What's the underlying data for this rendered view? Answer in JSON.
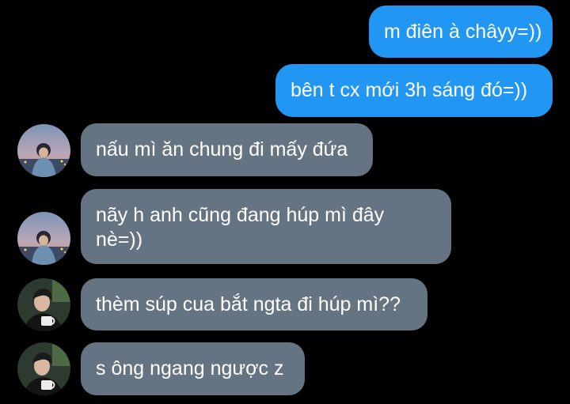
{
  "messages": [
    {
      "id": "m1",
      "direction": "outgoing",
      "text": "m điên à châyy=))"
    },
    {
      "id": "m2",
      "direction": "outgoing",
      "text": "bên t cx mới 3h sáng đó=))"
    },
    {
      "id": "m3",
      "direction": "incoming",
      "sender_avatar": "avatar-a",
      "text": "nấu mì ăn chung đi mấy đứa"
    },
    {
      "id": "m4",
      "direction": "incoming",
      "sender_avatar": "avatar-a",
      "text_line1": "nãy h anh cũng đang húp mì đây",
      "text_line2": "nè=))"
    },
    {
      "id": "m5",
      "direction": "incoming",
      "sender_avatar": "avatar-b",
      "text": "thèm súp cua bắt ngta đi húp mì??"
    },
    {
      "id": "m6",
      "direction": "incoming",
      "sender_avatar": "avatar-b",
      "text": "s ông ngang ngược z"
    }
  ],
  "colors": {
    "background": "#000000",
    "outgoing_bubble": "#2196f3",
    "incoming_bubble": "#657482",
    "text": "#ffffff"
  }
}
